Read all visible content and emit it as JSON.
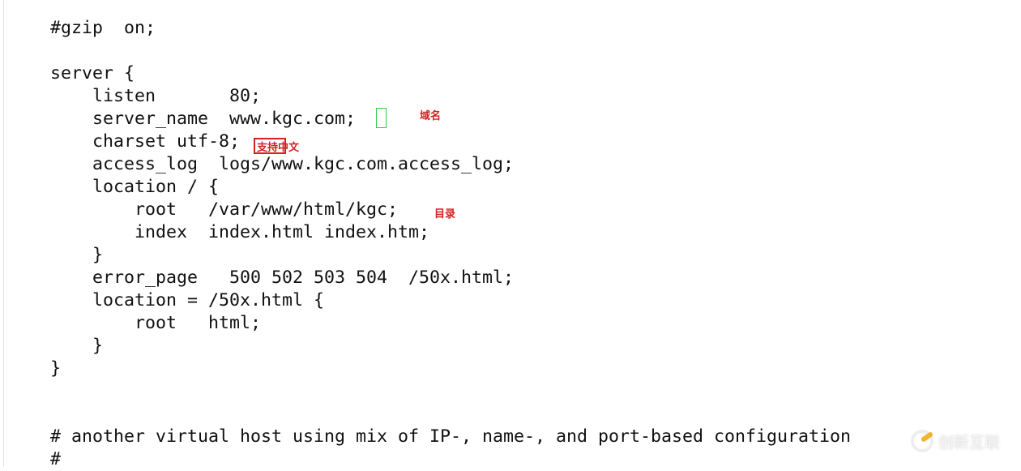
{
  "code_lines": [
    "#gzip  on;",
    "",
    "server {",
    "    listen       80;",
    "    server_name  www.kgc.com;",
    "    charset utf-8;",
    "    access_log  logs/www.kgc.com.access_log;",
    "    location / {",
    "        root   /var/www/html/kgc;",
    "        index  index.html index.htm;",
    "    }",
    "    error_page   500 502 503 504  /50x.html;",
    "    location = /50x.html {",
    "        root   html;",
    "    }",
    "}",
    "",
    "",
    "# another virtual host using mix of IP-, name-, and port-based configuration",
    "#"
  ],
  "annotations": {
    "domain_note": "域名",
    "charset_note": "支持中文",
    "root_note": "目录"
  },
  "watermark": "创新互联",
  "colors": {
    "annotation": "#d42020",
    "highlight_box": "#33cc44"
  }
}
